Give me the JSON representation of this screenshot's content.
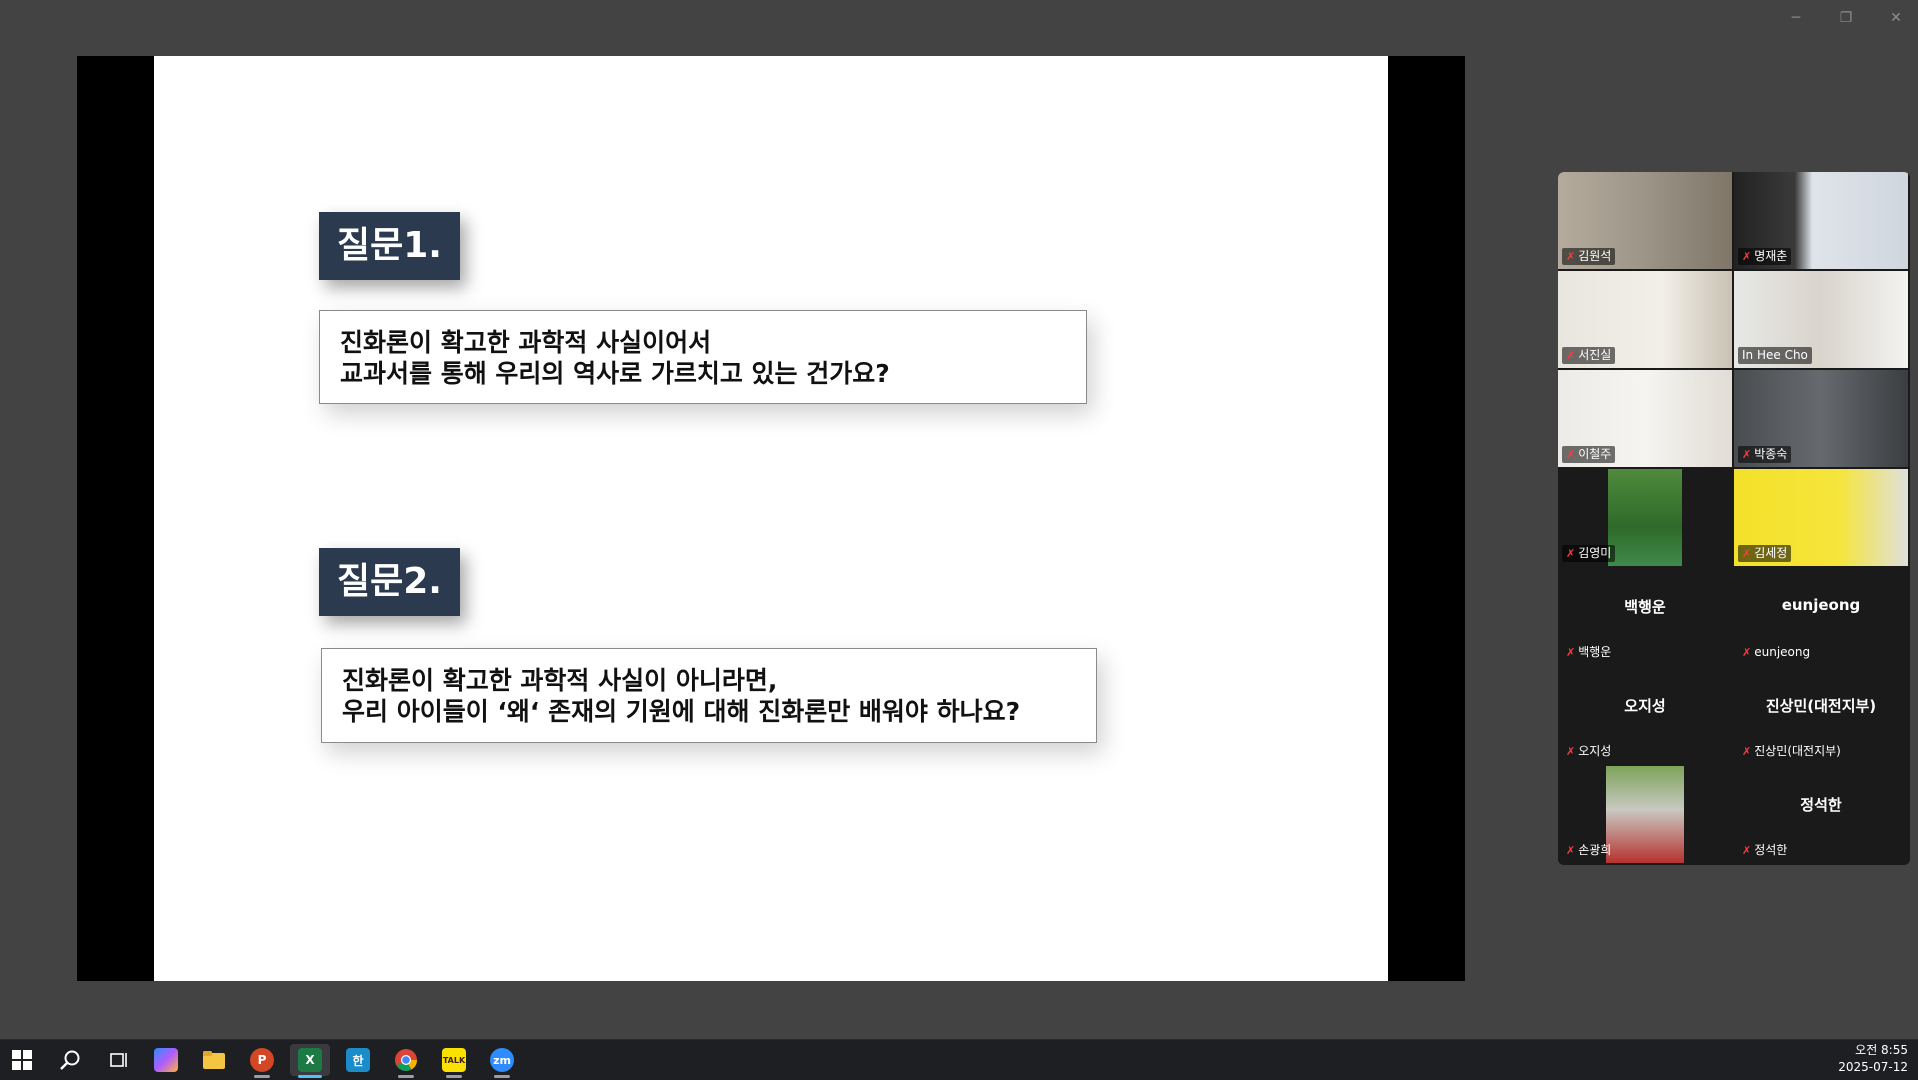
{
  "window": {
    "minimize_icon": "─",
    "restore_icon": "❐",
    "close_icon": "✕"
  },
  "slide": {
    "q1": {
      "title": "질문1.",
      "lines": [
        "진화론이 확고한 과학적 사실이어서",
        "교과서를 통해 우리의 역사로 가르치고 있는 건가요?"
      ]
    },
    "q2": {
      "title": "질문2.",
      "lines": [
        "진화론이 확고한 과학적 사실이 아니라면,",
        "우리 아이들이 ‘왜‘ 존재의 기원에 대해 진화론만 배워야 하나요?"
      ]
    }
  },
  "participants": [
    {
      "name": "김원석",
      "video": true,
      "muted": true,
      "active": false
    },
    {
      "name": "명재춘",
      "video": true,
      "muted": true,
      "active": false
    },
    {
      "name": "서진실",
      "video": true,
      "muted": true,
      "active": false
    },
    {
      "name": "In Hee Cho",
      "video": true,
      "muted": false,
      "active": true
    },
    {
      "name": "이철주",
      "video": true,
      "muted": true,
      "active": false
    },
    {
      "name": "박종숙",
      "video": true,
      "muted": true,
      "active": false
    },
    {
      "name": "김영미",
      "video": true,
      "muted": true,
      "active": false
    },
    {
      "name": "김세정",
      "video": true,
      "muted": true,
      "active": false
    },
    {
      "name": "백행운",
      "video": false,
      "muted": true,
      "active": false,
      "display": "백행운"
    },
    {
      "name": "eunjeong",
      "video": false,
      "muted": true,
      "active": false,
      "display": "eunjeong"
    },
    {
      "name": "오지성",
      "video": false,
      "muted": true,
      "active": false,
      "display": "오지성"
    },
    {
      "name": "진상민(대전지부)",
      "video": false,
      "muted": true,
      "active": false,
      "display": "진상민(대전지부)"
    },
    {
      "name": "손광희",
      "video": true,
      "muted": true,
      "active": false
    },
    {
      "name": "정석한",
      "video": false,
      "muted": true,
      "active": false,
      "display": "정석한"
    }
  ],
  "taskbar": {
    "apps": [
      "start",
      "search",
      "task-view",
      "copilot",
      "file-explorer",
      "powerpoint",
      "excel",
      "hangul",
      "chrome",
      "kakaotalk",
      "zoom"
    ],
    "icon_labels": {
      "powerpoint": "P",
      "excel": "X",
      "hangul": "한",
      "kakaotalk": "TALK",
      "zoom": "zm"
    },
    "time": "오전 8:55",
    "date": "2025-07-12"
  }
}
